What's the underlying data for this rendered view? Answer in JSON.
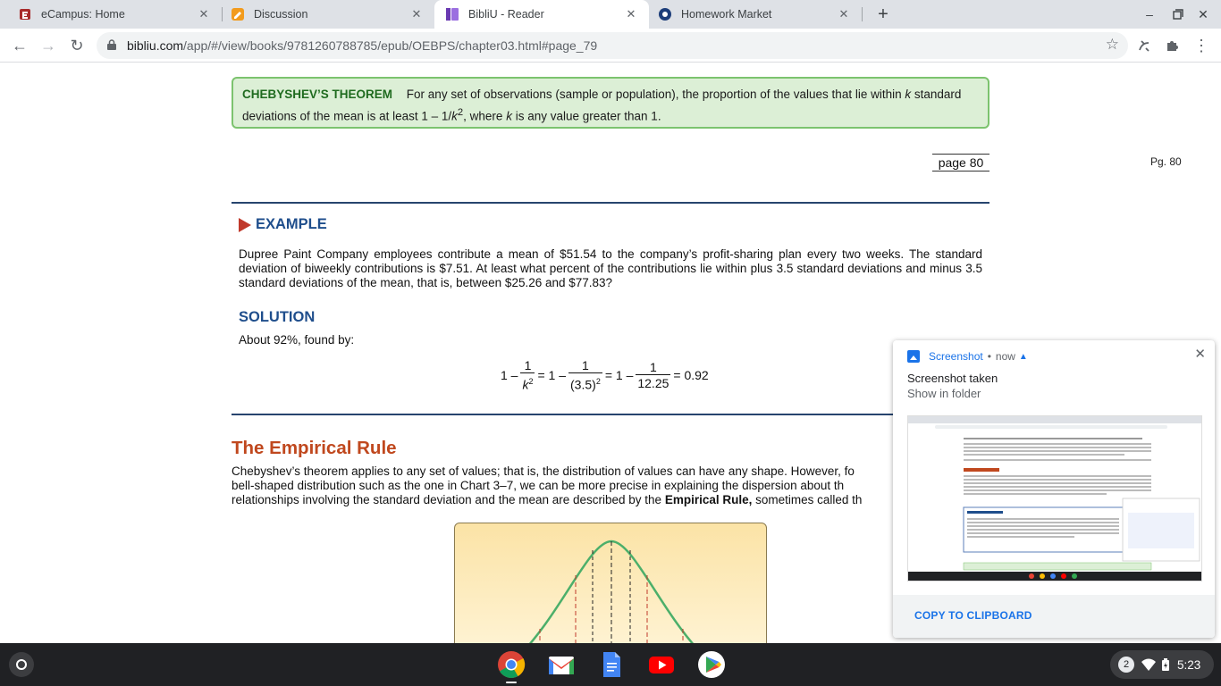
{
  "browser": {
    "tabs": [
      {
        "title": "eCampus: Home",
        "favicon": "ecampus-icon"
      },
      {
        "title": "Discussion",
        "favicon": "discussion-icon"
      },
      {
        "title": "BibliU - Reader",
        "favicon": "bibliu-icon",
        "active": true
      },
      {
        "title": "Homework Market",
        "favicon": "homework-market-icon"
      }
    ],
    "new_tab_label": "+",
    "url_host": "bibliu.com",
    "url_path": "/app/#/view/books/9781260788785/epub/OEBPS/chapter03.html#page_79"
  },
  "reader": {
    "theorem_head": "CHEBYSHEV’S THEOREM",
    "theorem_text_1": "For any set of observations (sample or population), the proportion of the values that lie within",
    "theorem_k1": "k",
    "theorem_text_2": "standard deviations of the mean is at least 1 – 1/",
    "theorem_k2": "k",
    "theorem_sup": "2",
    "theorem_text_3": ", where",
    "theorem_k3": "k",
    "theorem_text_4": "is any value greater than 1.",
    "page_box": "page 80",
    "page_marker": "Pg. 80",
    "example_head": "EXAMPLE",
    "example_text": "Dupree Paint Company employees contribute a mean of $51.54 to the company’s profit-sharing plan every two weeks. The standard deviation of biweekly contributions is $7.51. At least what percent of the contributions lie within plus 3.5 standard deviations and minus 3.5 standard deviations of the mean, that is, between $25.26 and $77.83?",
    "solution_head": "SOLUTION",
    "solution_text": "About 92%, found by:",
    "formula": {
      "one": "1 –",
      "num": "1",
      "den1": "k",
      "den1_sup": "2",
      "eq1": "= 1 –",
      "den2": "(3.5)",
      "den2_sup": "2",
      "eq2": "= 1 –",
      "den3": "12.25",
      "result": "= 0.92"
    },
    "empirical_head": "The Empirical Rule",
    "empirical_line1": "Chebyshev’s theorem applies to any set of values; that is, the distribution of values can have any shape. However, fo",
    "empirical_line2": "bell-shaped distribution such as the one in Chart 3–7, we can be more precise in explaining the dispersion about th",
    "empirical_line3_a": "relationships involving the standard deviation and the mean are described by the",
    "empirical_line3_bold": "Empirical Rule,",
    "empirical_line3_b": "sometimes called th"
  },
  "notification": {
    "app": "Screenshot",
    "separator": "•",
    "time": "now",
    "title": "Screenshot taken",
    "subtitle": "Show in folder",
    "action": "COPY TO CLIPBOARD"
  },
  "shelf": {
    "apps": [
      "chrome-icon",
      "gmail-icon",
      "docs-icon",
      "youtube-icon",
      "play-store-icon"
    ],
    "notification_count": "2",
    "time": "5:23"
  }
}
